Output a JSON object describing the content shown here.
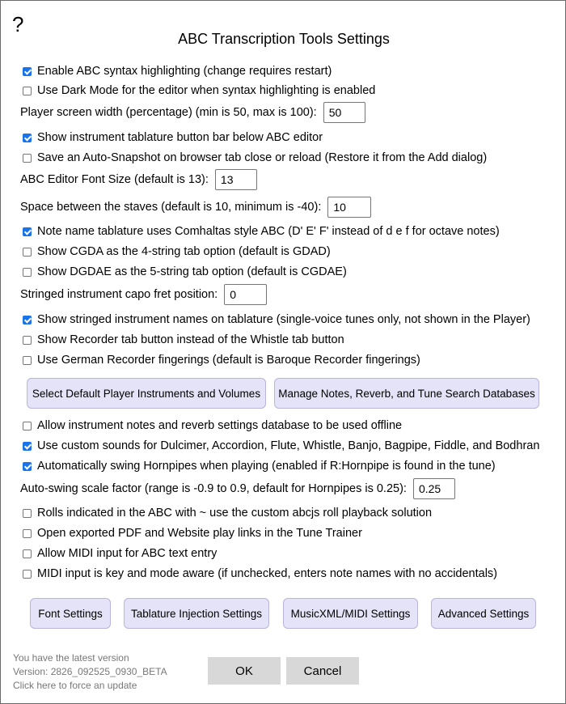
{
  "help_label": "?",
  "title": "ABC Transcription Tools Settings",
  "options": {
    "syntax_highlighting": {
      "label": "Enable ABC syntax highlighting (change requires restart)",
      "checked": true
    },
    "dark_mode": {
      "label": "Use Dark Mode for the editor when syntax highlighting is enabled",
      "checked": false
    },
    "player_width": {
      "label": "Player screen width (percentage) (min is 50, max is 100):",
      "value": "50"
    },
    "tab_button_bar": {
      "label": "Show instrument tablature button bar below ABC editor",
      "checked": true
    },
    "auto_snapshot": {
      "label": "Save an Auto-Snapshot on browser tab close or reload (Restore it from the Add dialog)",
      "checked": false
    },
    "font_size": {
      "label": "ABC Editor Font Size (default is 13):",
      "value": "13"
    },
    "staff_space": {
      "label": "Space between the staves (default is 10, minimum is -40):",
      "value": "10"
    },
    "comhaltas": {
      "label": "Note name tablature uses Comhaltas style ABC (D' E' F' instead of d e f for octave notes)",
      "checked": true
    },
    "cgda": {
      "label": "Show CGDA as the 4-string tab option (default is GDAD)",
      "checked": false
    },
    "dgdae": {
      "label": "Show DGDAE as the 5-string tab option (default is CGDAE)",
      "checked": false
    },
    "capo": {
      "label": "Stringed instrument capo fret position:",
      "value": "0"
    },
    "string_names": {
      "label": "Show stringed instrument names on tablature (single-voice tunes only, not shown in the Player)",
      "checked": true
    },
    "recorder_tab": {
      "label": "Show Recorder tab button instead of the Whistle tab button",
      "checked": false
    },
    "german_recorder": {
      "label": "Use German Recorder fingerings (default is Baroque Recorder fingerings)",
      "checked": false
    },
    "offline_db": {
      "label": "Allow instrument notes and reverb settings database to be used offline",
      "checked": false
    },
    "custom_sounds": {
      "label": "Use custom sounds for Dulcimer, Accordion, Flute, Whistle, Banjo, Bagpipe, Fiddle, and Bodhran",
      "checked": true
    },
    "swing_hornpipes": {
      "label": "Automatically swing Hornpipes when playing (enabled if R:Hornpipe is found in the tune)",
      "checked": true
    },
    "swing_factor": {
      "label": "Auto-swing scale factor (range is -0.9 to 0.9, default for Hornpipes is 0.25):",
      "value": "0.25"
    },
    "rolls": {
      "label": "Rolls indicated in the ABC with ~ use the custom abcjs roll playback solution",
      "checked": false
    },
    "open_pdf": {
      "label": "Open exported PDF and Website play links in the Tune Trainer",
      "checked": false
    },
    "midi_input": {
      "label": "Allow MIDI input for ABC text entry",
      "checked": false
    },
    "midi_key_aware": {
      "label": "MIDI input is key and mode aware (if unchecked, enters note names with no accidentals)",
      "checked": false
    }
  },
  "buttons": {
    "default_instruments": "Select Default Player Instruments and Volumes",
    "manage_databases": "Manage Notes, Reverb, and Tune Search Databases",
    "font_settings": "Font Settings",
    "tablature_injection": "Tablature Injection Settings",
    "musicxml_midi": "MusicXML/MIDI Settings",
    "advanced": "Advanced Settings",
    "ok": "OK",
    "cancel": "Cancel"
  },
  "footer": {
    "latest": "You have the latest version",
    "version": "Version: 2826_092525_0930_BETA",
    "force_update": "Click here to force an update"
  },
  "colors": {
    "accent_checkbox": "#1a73e8",
    "button_fill": "#e4e3f7",
    "button_gray": "#d8d8d8"
  }
}
